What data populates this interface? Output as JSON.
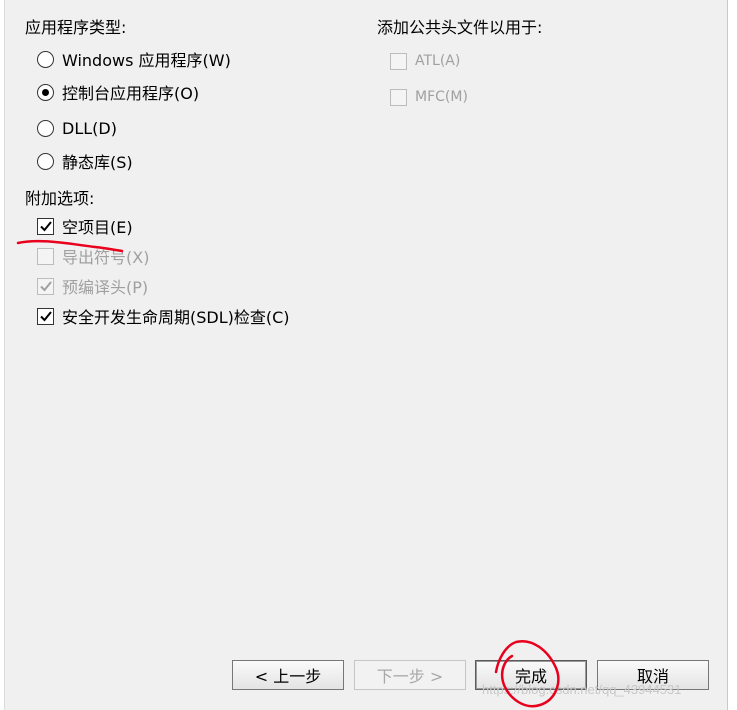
{
  "app_type": {
    "heading": "应用程序类型:",
    "options": [
      {
        "label": "Windows 应用程序(W)",
        "selected": false
      },
      {
        "label": "控制台应用程序(O)",
        "selected": true
      },
      {
        "label": "DLL(D)",
        "selected": false
      },
      {
        "label": "静态库(S)",
        "selected": false
      }
    ]
  },
  "headers": {
    "heading": "添加公共头文件以用于:",
    "options": [
      {
        "label": "ATL(A)",
        "checked": false,
        "enabled": false
      },
      {
        "label": "MFC(M)",
        "checked": false,
        "enabled": false
      }
    ]
  },
  "extra": {
    "heading": "附加选项:",
    "options": [
      {
        "label": "空项目(E)",
        "checked": true,
        "enabled": true
      },
      {
        "label": "导出符号(X)",
        "checked": false,
        "enabled": false
      },
      {
        "label": "预编译头(P)",
        "checked": true,
        "enabled": false
      },
      {
        "label": "安全开发生命周期(SDL)检查(C)",
        "checked": true,
        "enabled": true
      }
    ]
  },
  "buttons": {
    "back": "< 上一步",
    "next": "下一步 >",
    "finish": "完成",
    "cancel": "取消"
  },
  "watermark": "https://blog.csdn.net/qq_43944531",
  "annotation_color": "#e8001c"
}
